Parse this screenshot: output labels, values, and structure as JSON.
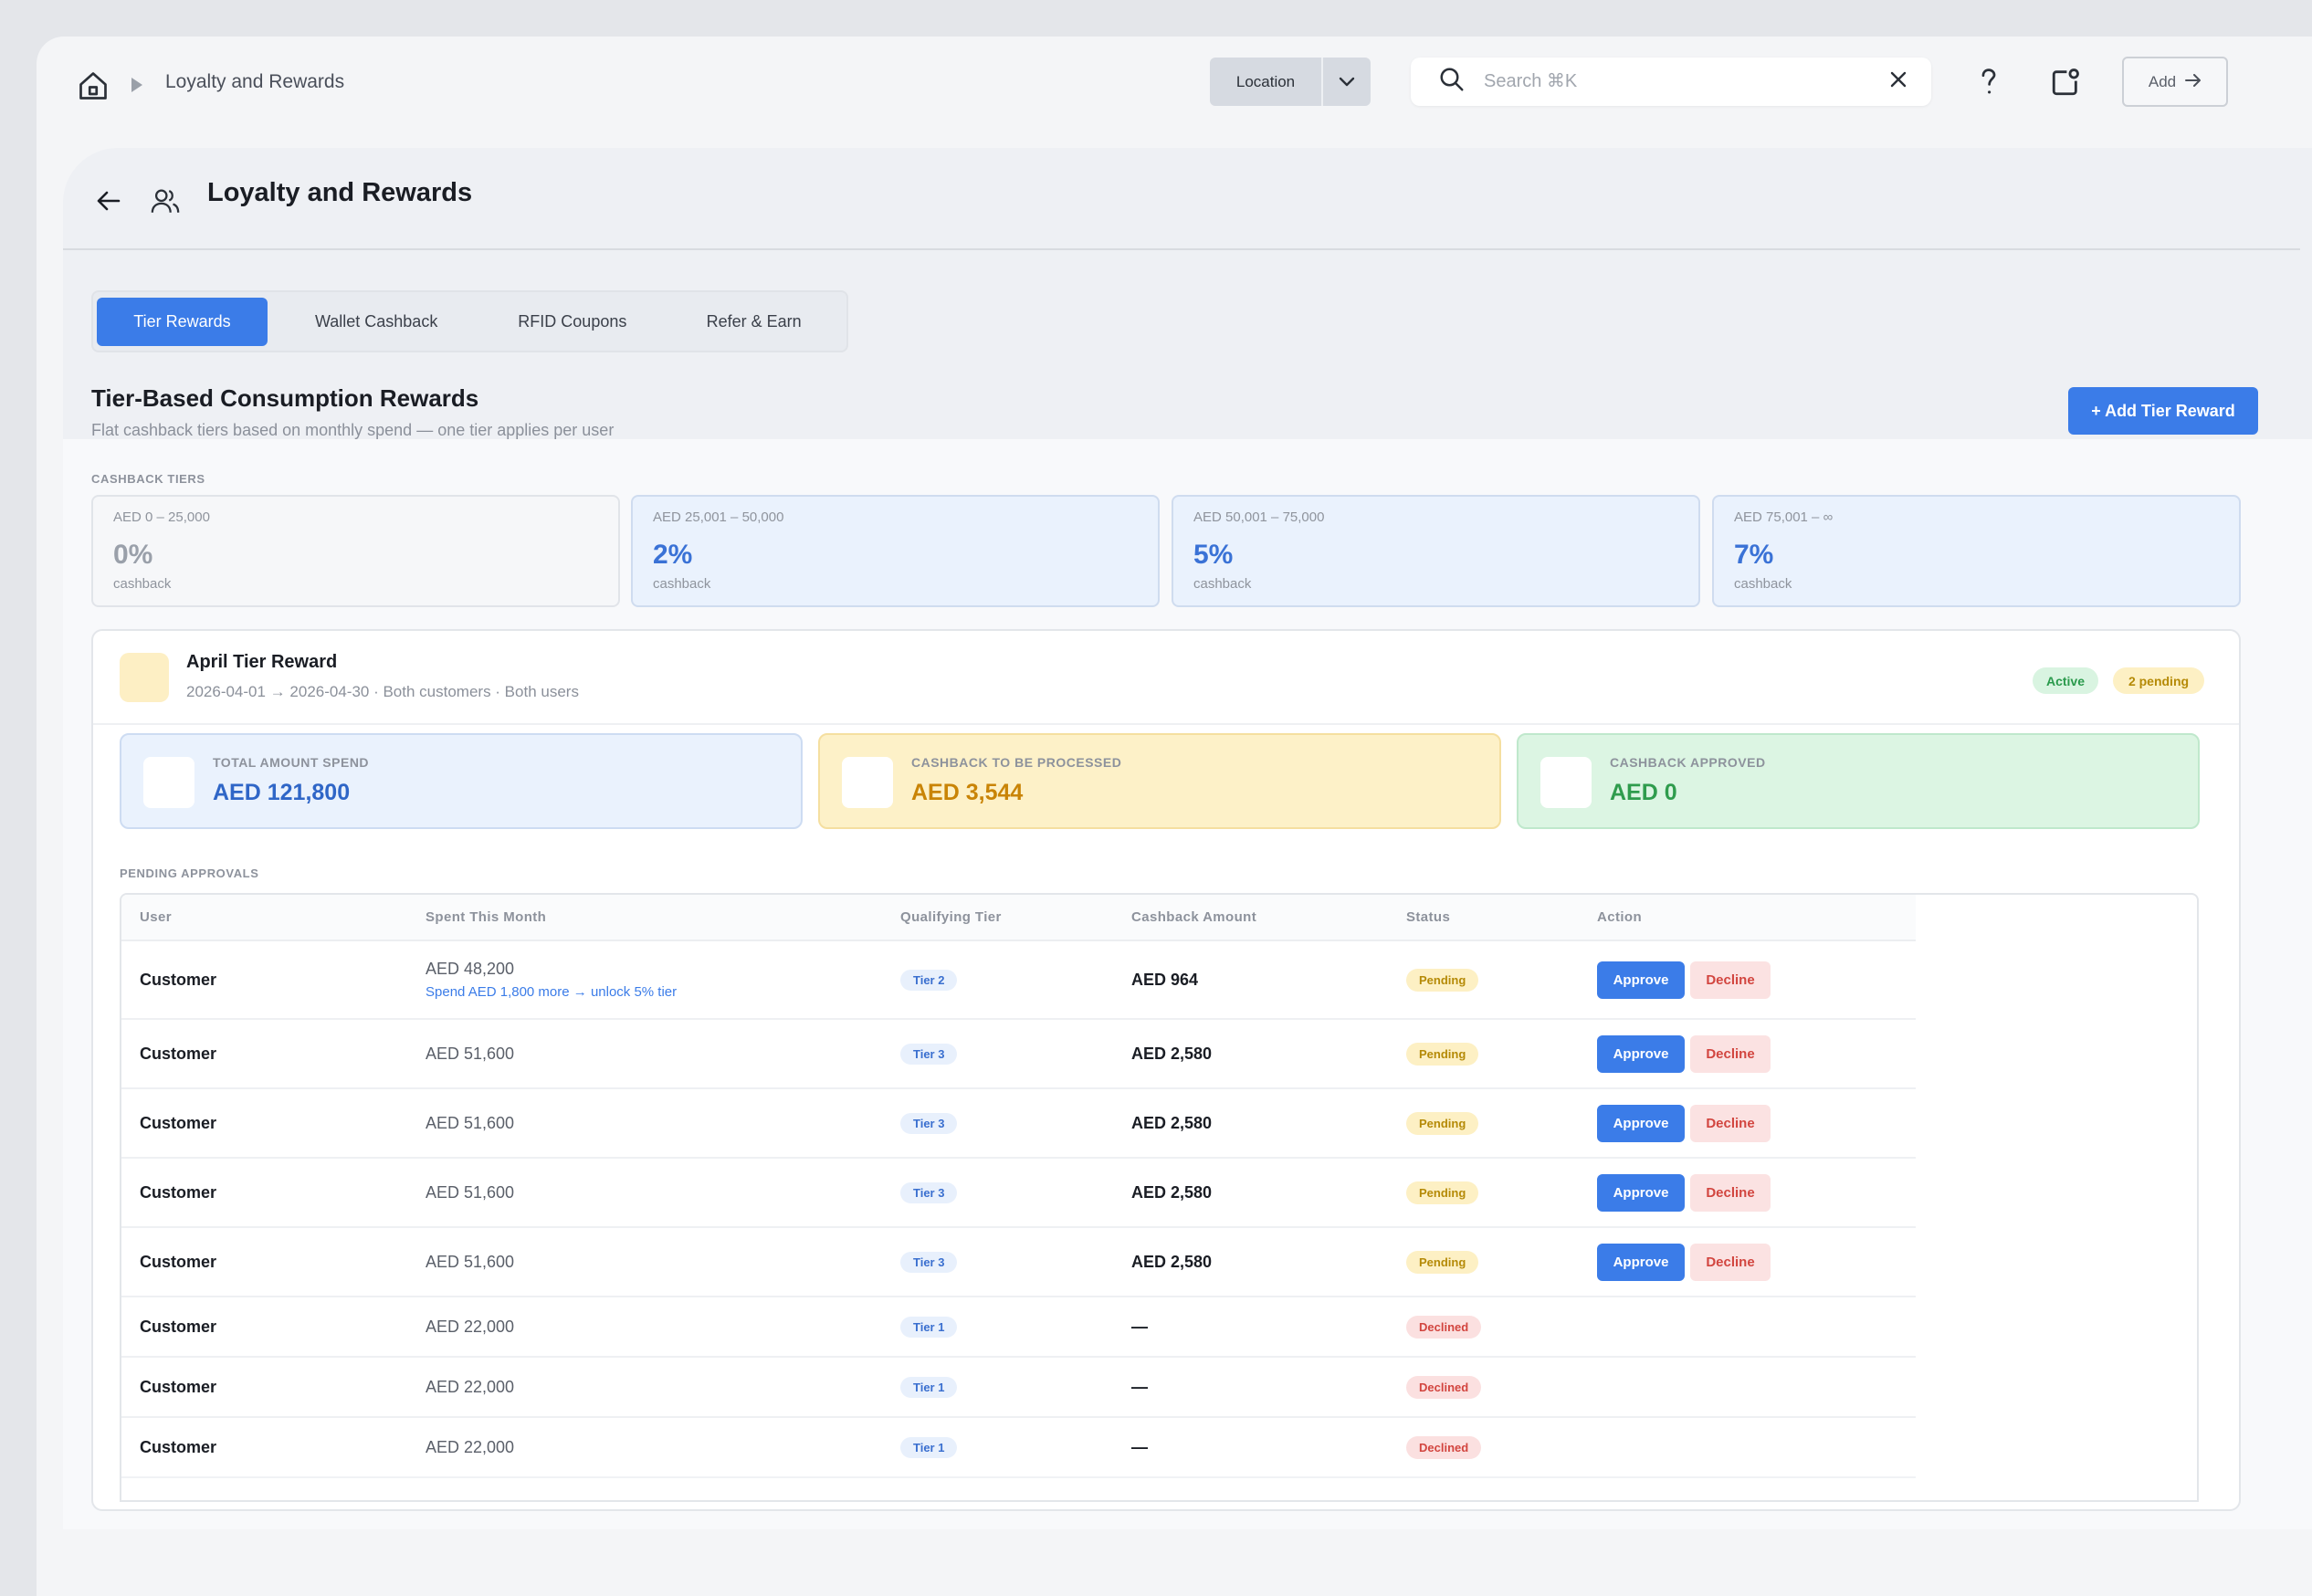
{
  "topbar": {
    "breadcrumb": "Loyalty and Rewards",
    "location_label": "Location",
    "search_placeholder": "Search ⌘K",
    "add_label": "Add"
  },
  "page": {
    "title": "Loyalty and Rewards"
  },
  "tabs": [
    {
      "label": "Tier Rewards",
      "active": true
    },
    {
      "label": "Wallet Cashback",
      "active": false
    },
    {
      "label": "RFID Coupons",
      "active": false
    },
    {
      "label": "Refer & Earn",
      "active": false
    }
  ],
  "section": {
    "title": "Tier-Based Consumption Rewards",
    "subtitle": "Flat cashback tiers based on monthly spend — one tier applies per user",
    "add_button": "+ Add Tier Reward",
    "tiers_caption": "CASHBACK TIERS"
  },
  "tiers": [
    {
      "range": "AED 0 – 25,000",
      "pct": "0%",
      "unit": "cashback"
    },
    {
      "range": "AED 25,001 – 50,000",
      "pct": "2%",
      "unit": "cashback"
    },
    {
      "range": "AED 50,001 – 75,000",
      "pct": "5%",
      "unit": "cashback"
    },
    {
      "range": "AED 75,001 – ∞",
      "pct": "7%",
      "unit": "cashback"
    }
  ],
  "reward": {
    "name": "April Tier Reward",
    "meta": "2026-04-01 → 2026-04-30 · Both customers · Both users",
    "status": "Active",
    "pending_count": "2 pending"
  },
  "stats": {
    "total": {
      "label": "TOTAL AMOUNT SPEND",
      "value": "AED 121,800"
    },
    "to_process": {
      "label": "CASHBACK TO BE PROCESSED",
      "value": "AED 3,544"
    },
    "approved": {
      "label": "CASHBACK APPROVED",
      "value": "AED 0"
    }
  },
  "approvals": {
    "caption": "PENDING APPROVALS",
    "columns": [
      "User",
      "Spent This Month",
      "Qualifying Tier",
      "Cashback Amount",
      "Status",
      "Action"
    ],
    "approve_label": "Approve",
    "decline_label": "Decline",
    "rows": [
      {
        "user": "Customer",
        "spent": "AED 48,200",
        "hint": "Spend AED 1,800 more → unlock 5% tier",
        "tier": "Tier 2",
        "amount": "AED 964",
        "status": "Pending"
      },
      {
        "user": "Customer",
        "spent": "AED 51,600",
        "hint": "",
        "tier": "Tier 3",
        "amount": "AED 2,580",
        "status": "Pending"
      },
      {
        "user": "Customer",
        "spent": "AED 51,600",
        "hint": "",
        "tier": "Tier 3",
        "amount": "AED 2,580",
        "status": "Pending"
      },
      {
        "user": "Customer",
        "spent": "AED 51,600",
        "hint": "",
        "tier": "Tier 3",
        "amount": "AED 2,580",
        "status": "Pending"
      },
      {
        "user": "Customer",
        "spent": "AED 51,600",
        "hint": "",
        "tier": "Tier 3",
        "amount": "AED 2,580",
        "status": "Pending"
      },
      {
        "user": "Customer",
        "spent": "AED 22,000",
        "hint": "",
        "tier": "Tier 1",
        "amount": "—",
        "status": "Declined"
      },
      {
        "user": "Customer",
        "spent": "AED 22,000",
        "hint": "",
        "tier": "Tier 1",
        "amount": "—",
        "status": "Declined"
      },
      {
        "user": "Customer",
        "spent": "AED 22,000",
        "hint": "",
        "tier": "Tier 1",
        "amount": "—",
        "status": "Declined"
      }
    ]
  },
  "colors": {
    "accent": "#3b7ce8",
    "pending": "#b58a07",
    "declined": "#d2453f",
    "active": "#2a9a4c"
  }
}
